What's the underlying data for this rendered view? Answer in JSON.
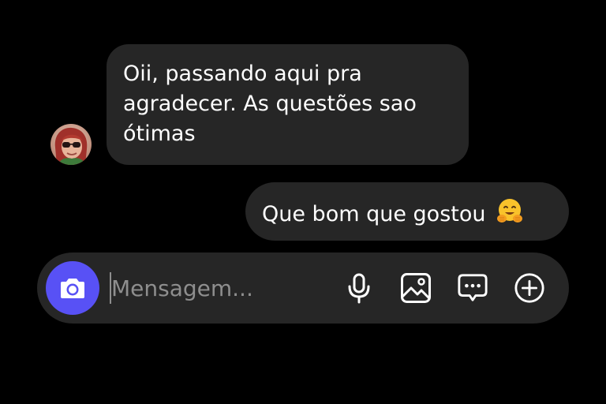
{
  "conversation": {
    "incoming": {
      "avatar_icon": "contact-avatar",
      "text": "Oii, passando aqui pra agradecer. As questões sao ótimas"
    },
    "outgoing": {
      "text": "Que bom que gostou",
      "emoji_icon": "hugging-face-emoji"
    }
  },
  "composer": {
    "placeholder": "Mensagem...",
    "camera_icon": "camera-icon",
    "tools": [
      "microphone-icon",
      "image-icon",
      "sticker-message-icon",
      "plus-circle-icon"
    ],
    "accent_color": "#5851f5"
  },
  "colors": {
    "background": "#000000",
    "bubble": "#262626",
    "text": "#ffffff",
    "placeholder": "#8e8e8e"
  }
}
